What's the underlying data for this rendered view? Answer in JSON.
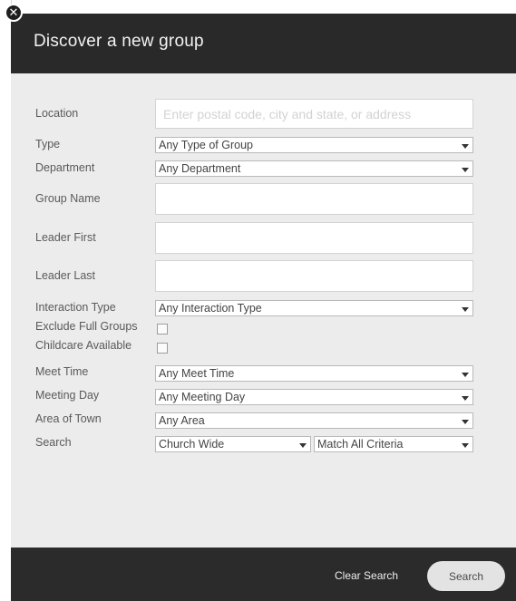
{
  "dialog": {
    "title": "Discover a new group",
    "close_icon": "close-icon"
  },
  "form": {
    "location": {
      "label": "Location",
      "value": "",
      "placeholder": "Enter postal code, city and state, or address"
    },
    "type": {
      "label": "Type",
      "selected": "Any Type of Group"
    },
    "department": {
      "label": "Department",
      "selected": "Any Department"
    },
    "group_name": {
      "label": "Group Name",
      "value": ""
    },
    "leader_first": {
      "label": "Leader First",
      "value": ""
    },
    "leader_last": {
      "label": "Leader Last",
      "value": ""
    },
    "interaction_type": {
      "label": "Interaction Type",
      "selected": "Any Interaction Type"
    },
    "exclude_full_groups": {
      "label": "Exclude Full Groups",
      "checked": false
    },
    "childcare_available": {
      "label": "Childcare Available",
      "checked": false
    },
    "meet_time": {
      "label": "Meet Time",
      "selected": "Any Meet Time"
    },
    "meeting_day": {
      "label": "Meeting Day",
      "selected": "Any Meeting Day"
    },
    "area_of_town": {
      "label": "Area of Town",
      "selected": "Any Area"
    },
    "search_scope": {
      "label": "Search",
      "scope_selected": "Church Wide",
      "criteria_selected": "Match All Criteria"
    }
  },
  "footer": {
    "clear_label": "Clear Search",
    "search_label": "Search"
  },
  "colors": {
    "header_bg": "#292929",
    "body_bg": "#ececec",
    "footer_bg": "#2b2b2b",
    "button_bg": "#e3e3e3"
  }
}
